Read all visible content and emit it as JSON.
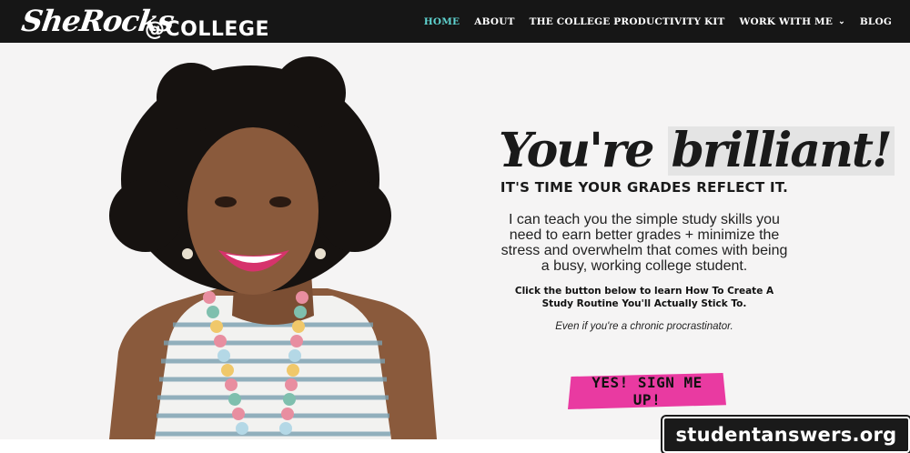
{
  "brand": {
    "logo_script": "SheRocks",
    "logo_text": "@COLLEGE"
  },
  "nav": {
    "items": [
      {
        "label": "HOME",
        "active": true
      },
      {
        "label": "ABOUT"
      },
      {
        "label": "THE COLLEGE PRODUCTIVITY KIT"
      },
      {
        "label": "WORK WITH ME",
        "has_dropdown": true
      },
      {
        "label": "BLOG"
      }
    ]
  },
  "hero": {
    "headline_part1": "You're ",
    "headline_part2": "brilliant!",
    "subheadline": "IT'S TIME YOUR GRADES REFLECT IT.",
    "body": "I can teach you the simple study skills you need to earn better grades + minimize the stress and overwhelm that comes with being a busy, working college student.",
    "cta_lead": "Click the button below to learn How To Create A Study Routine You'll Actually Stick To.",
    "note": "Even if you're a chronic procrastinator.",
    "button_label": "YES! SIGN ME UP!"
  },
  "watermark": "studentanswers.org",
  "colors": {
    "nav_bg": "#161616",
    "nav_active": "#5fd3d0",
    "button_pink": "#e93aa1",
    "hero_bg": "#f5f4f4"
  },
  "icons": {
    "dropdown": "chevron-down-icon"
  }
}
